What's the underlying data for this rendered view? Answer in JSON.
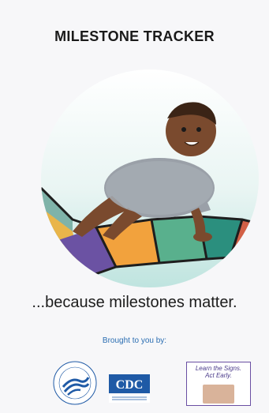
{
  "app": {
    "title": "MILESTONE TRACKER",
    "tagline": "...because milestones matter.",
    "brought_label": "Brought to you by:"
  },
  "partners": {
    "cdc_text": "CDC",
    "ltsae_text_line1": "Learn the Signs.",
    "ltsae_text_line2": "Act Early."
  },
  "icons": {
    "hhs": "hhs-seal-icon",
    "cdc": "cdc-logo-icon",
    "ltsae": "learn-the-signs-logo-icon"
  },
  "colors": {
    "title": "#1a1a1a",
    "brought": "#2a6db2",
    "cdc_blue": "#1f5aa6"
  }
}
